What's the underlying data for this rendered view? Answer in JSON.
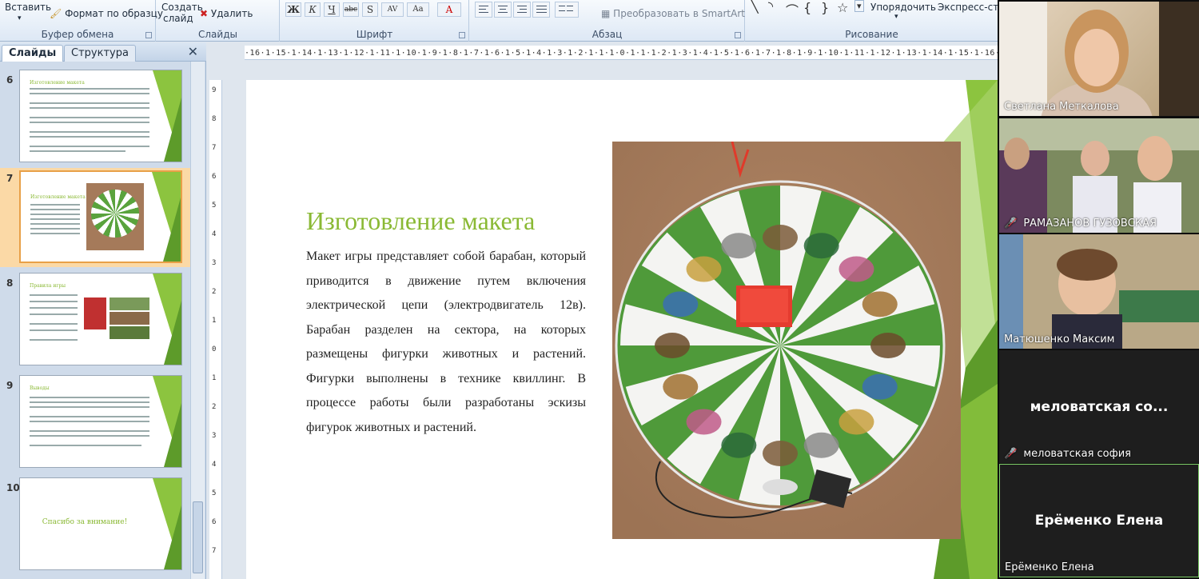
{
  "ribbon": {
    "clipboard": {
      "paste_label": "Вставить",
      "format_painter_label": "Формат по образцу",
      "group_label": "Буфер обмена"
    },
    "slides": {
      "new_slide_label": "Создать",
      "new_slide_label2": "слайд",
      "delete_label": "Удалить",
      "group_label": "Слайды"
    },
    "font": {
      "bold": "Ж",
      "italic": "К",
      "underline": "Ч",
      "strike": "abc",
      "shadow": "S",
      "spacing": "AV",
      "case": "Aa",
      "color": "A",
      "group_label": "Шрифт"
    },
    "paragraph": {
      "smartart_label": "Преобразовать в SmartArt",
      "group_label": "Абзац"
    },
    "drawing": {
      "arrange_label": "Упорядочить",
      "quick_styles_label": "Экспресс-стили",
      "group_label": "Рисование"
    }
  },
  "panel": {
    "tab_slides": "Слайды",
    "tab_outline": "Структура",
    "close_glyph": "✕",
    "thumbnails": [
      {
        "num": "6",
        "title": "Изготовление макета"
      },
      {
        "num": "7",
        "title": "Изготовление макета"
      },
      {
        "num": "8",
        "title": "Правила игры"
      },
      {
        "num": "9",
        "title": "Выводы"
      },
      {
        "num": "10",
        "title": "Спасибо за внимание!"
      }
    ]
  },
  "ruler": {
    "h_ticks": "·16·1·15·1·14·1·13·1·12·1·11·1·10·1·9·1·8·1·7·1·6·1·5·1·4·1·3·1·2·1·1·1·0·1·1·1·2·1·3·1·4·1·5·1·6·1·7·1·8·1·9·1·10·1·11·1·12·1·13·1·14·1·15·1·16·"
  },
  "slide": {
    "title": "Изготовление макета",
    "body": "Макет игры представляет собой барабан, который    приводится в движение путем включения    электрической    цепи (электродвигатель 12в).  Барабан разделен на сектора, на которых размещены фигурки животных и растений. Фигурки выполнены в технике квиллинг. В процессе работы были разработаны эскизы фигурок животных и растений."
  },
  "participants": [
    {
      "name": "Светлана Меткалова",
      "muted": false
    },
    {
      "name": "РАМАЗАНОВ ГУЗОВСКАЯ",
      "muted": true
    },
    {
      "name": "Матюшенко Максим",
      "muted": false
    },
    {
      "name": "меловатская софия",
      "muted": true,
      "center_label": "меловатская со..."
    },
    {
      "name": "Ерёменко Елена",
      "muted": false,
      "center_label": "Ерёменко Елена"
    }
  ],
  "colors": {
    "accent_green": "#8ab934",
    "ribbon_bg": "#dde8f5",
    "selected_thumb": "#fbd9a6"
  }
}
